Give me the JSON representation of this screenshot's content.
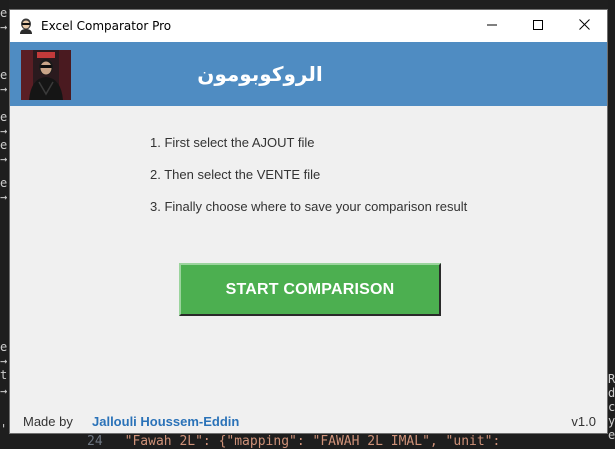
{
  "background": {
    "left_fragments": [
      "e",
      "→",
      "e",
      "→",
      "e",
      "→",
      "e",
      "→",
      "e",
      "→",
      "e",
      "→",
      "t",
      "→",
      "'"
    ],
    "right_fragments": [
      "R",
      "d",
      "c",
      "y",
      "e"
    ],
    "bottom_line_number": "24",
    "bottom_code": "\"Fawah 2L\": {\"mapping\": \"FAWAH 2L IMAL\", \"unit\":"
  },
  "window": {
    "title": "Excel Comparator Pro",
    "app_icon": "person-icon",
    "controls": {
      "minimize_icon": "minimize-icon",
      "maximize_icon": "maximize-icon",
      "close_icon": "close-icon"
    }
  },
  "header": {
    "title": "الروكوبومون",
    "background_color": "#4f8cc2",
    "avatar": "avatar-photo"
  },
  "steps": [
    "1. First select the AJOUT file",
    "2. Then select the VENTE file",
    "3. Finally choose where to save your comparison result"
  ],
  "actions": {
    "start_label": "START COMPARISON",
    "start_color": "#4caf50"
  },
  "footer": {
    "made_by_label": "Made by",
    "author": "Jallouli Houssem-Eddin",
    "author_color": "#2a72b8",
    "version": "v1.0"
  }
}
